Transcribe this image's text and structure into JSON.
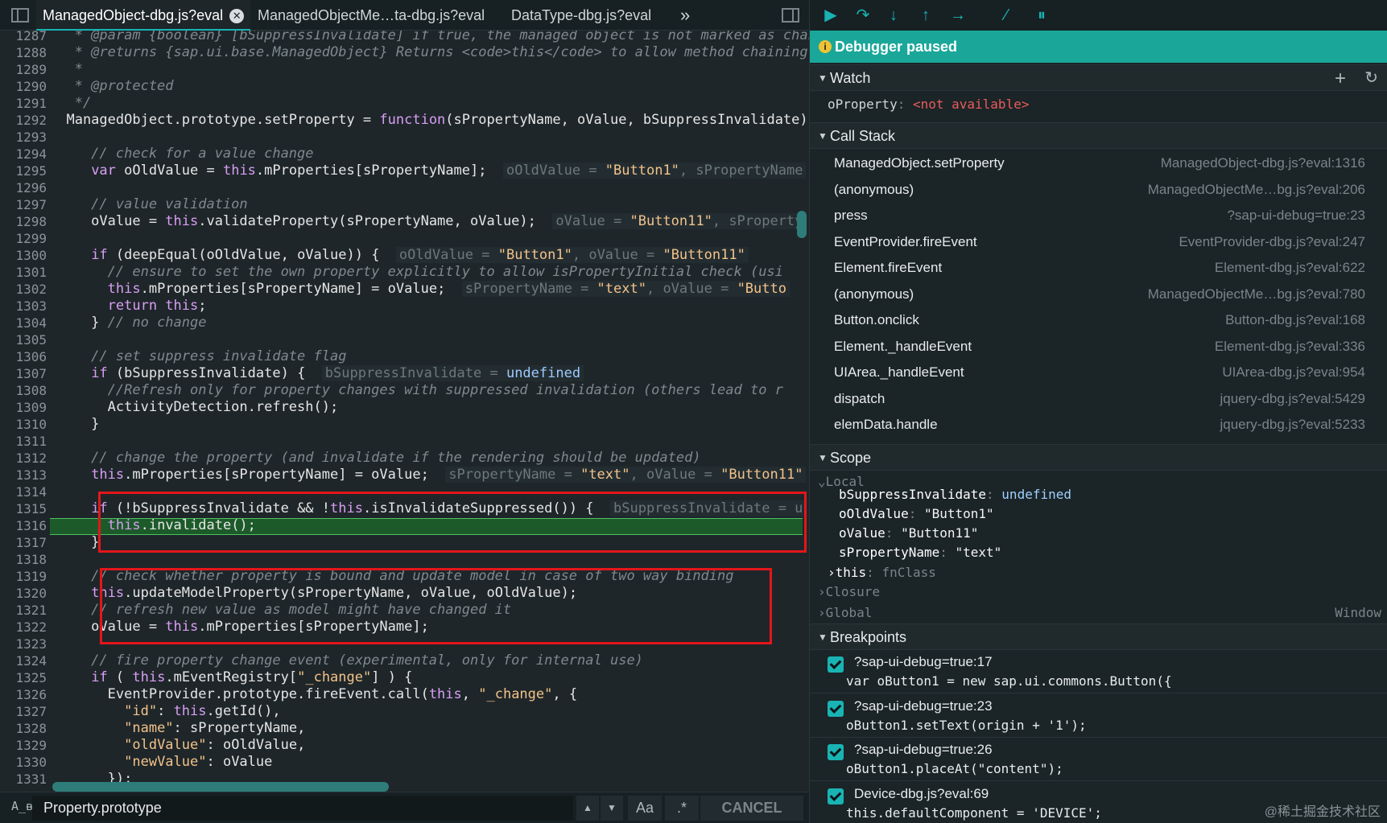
{
  "tabs": [
    {
      "label": "ManagedObject-dbg.js?eval",
      "active": true
    },
    {
      "label": "ManagedObjectMe…ta-dbg.js?eval",
      "active": false
    },
    {
      "label": "DataType-dbg.js?eval",
      "active": false
    }
  ],
  "tabs_more": "»",
  "editor": {
    "first_line": 1287,
    "lines": [
      {
        "n": "1287",
        "html": "<span class='cm'>   * @param {boolean} [bSuppressInvalidate] if true, the managed object is not marked as changed</span>"
      },
      {
        "n": "1288",
        "html": "<span class='cm'>   * @returns {sap.ui.base.ManagedObject} Returns &lt;code&gt;this&lt;/code&gt; to allow method chaining</span>"
      },
      {
        "n": "1289",
        "html": "<span class='cm'>   *</span>"
      },
      {
        "n": "1290",
        "html": "<span class='cm'>   * @protected</span>"
      },
      {
        "n": "1291",
        "html": "<span class='cm'>   */</span>"
      },
      {
        "n": "1292",
        "html": "  ManagedObject.prototype.setProperty = <span class='kw'>function</span>(sPropertyName, oValue, bSuppressInvalidate) {"
      },
      {
        "n": "1293",
        "html": ""
      },
      {
        "n": "1294",
        "html": "<span class='cm'>     // check for a value change</span>"
      },
      {
        "n": "1295",
        "html": "     <span class='kw'>var</span> oOldValue = <span class='kw'>this</span>.mProperties[sPropertyName];  <span class='inl'>oOldValue = <span class='st'>\"Button1\"</span>, sPropertyName</span>"
      },
      {
        "n": "1296",
        "html": ""
      },
      {
        "n": "1297",
        "html": "<span class='cm'>     // value validation</span>"
      },
      {
        "n": "1298",
        "html": "     oValue = <span class='kw'>this</span>.validateProperty(sPropertyName, oValue);  <span class='inl'>oValue = <span class='st'>\"Button11\"</span>, sProperty</span>"
      },
      {
        "n": "1299",
        "html": ""
      },
      {
        "n": "1300",
        "html": "     <span class='kw'>if</span> (deepEqual(oOldValue, oValue)) {  <span class='inl'>oOldValue = <span class='st'>\"Button1\"</span>, oValue = <span class='st'>\"Button11\"</span></span>"
      },
      {
        "n": "1301",
        "html": "<span class='cm'>       // ensure to set the own property explicitly to allow isPropertyInitial check (usi</span>"
      },
      {
        "n": "1302",
        "html": "       <span class='kw'>this</span>.mProperties[sPropertyName] = oValue;  <span class='inl'>sPropertyName = <span class='st'>\"text\"</span>, oValue = <span class='st'>\"Butto</span></span>"
      },
      {
        "n": "1303",
        "html": "       <span class='kw'>return this</span>;"
      },
      {
        "n": "1304",
        "html": "     } <span class='cm'>// no change</span>"
      },
      {
        "n": "1305",
        "html": ""
      },
      {
        "n": "1306",
        "html": "<span class='cm'>     // set suppress invalidate flag</span>"
      },
      {
        "n": "1307",
        "html": "     <span class='kw'>if</span> (bSuppressInvalidate) {  <span class='inl'>bSuppressInvalidate = <span class='kw'>undefined</span></span>"
      },
      {
        "n": "1308",
        "html": "<span class='cm'>       //Refresh only for property changes with suppressed invalidation (others lead to r</span>"
      },
      {
        "n": "1309",
        "html": "       ActivityDetection.refresh();"
      },
      {
        "n": "1310",
        "html": "     }"
      },
      {
        "n": "1311",
        "html": ""
      },
      {
        "n": "1312",
        "html": "<span class='cm'>     // change the property (and invalidate if the rendering should be updated)</span>"
      },
      {
        "n": "1313",
        "html": "     <span class='kw'>this</span>.mProperties[sPropertyName] = oValue;  <span class='inl'>sPropertyName = <span class='st'>\"text\"</span>, oValue = <span class='st'>\"Button11\"</span></span>"
      },
      {
        "n": "1314",
        "html": ""
      },
      {
        "n": "1315",
        "html": "     <span class='kw'>if</span> (!bSuppressInvalidate &amp;&amp; !<span class='kw'>this</span>.isInvalidateSuppressed()) {  <span class='inl'>bSuppressInvalidate = u</span>"
      },
      {
        "n": "1316",
        "html": "       <span class='kw'>this</span>.invalidate();"
      },
      {
        "n": "1317",
        "html": "     }"
      },
      {
        "n": "1318",
        "html": ""
      },
      {
        "n": "1319",
        "html": "<span class='cm'>     // check whether property is bound and update model in case of two way binding</span>"
      },
      {
        "n": "1320",
        "html": "     <span class='kw'>this</span>.updateModelProperty(sPropertyName, oValue, oOldValue);"
      },
      {
        "n": "1321",
        "html": "<span class='cm'>     // refresh new value as model might have changed it</span>"
      },
      {
        "n": "1322",
        "html": "     oValue = <span class='kw'>this</span>.mProperties[sPropertyName];"
      },
      {
        "n": "1323",
        "html": ""
      },
      {
        "n": "1324",
        "html": "<span class='cm'>     // fire property change event (experimental, only for internal use)</span>"
      },
      {
        "n": "1325",
        "html": "     <span class='kw'>if</span> ( <span class='kw'>this</span>.mEventRegistry[<span class='st'>\"_change\"</span>] ) {"
      },
      {
        "n": "1326",
        "html": "       EventProvider.prototype.fireEvent.call(<span class='kw'>this</span>, <span class='st'>\"_change\"</span>, {"
      },
      {
        "n": "1327",
        "html": "         <span class='st'>\"id\"</span>: <span class='kw'>this</span>.getId(),"
      },
      {
        "n": "1328",
        "html": "         <span class='st'>\"name\"</span>: sPropertyName,"
      },
      {
        "n": "1329",
        "html": "         <span class='st'>\"oldValue\"</span>: oOldValue,"
      },
      {
        "n": "1330",
        "html": "         <span class='st'>\"newValue\"</span>: oValue"
      },
      {
        "n": "1331",
        "html": "       });"
      }
    ],
    "paused_line": "1316"
  },
  "search": {
    "value": "Property.prototype",
    "case_label": "Aa",
    "regex_label": ".*",
    "cancel_label": "CANCEL"
  },
  "debugger": {
    "paused_label": "Debugger paused",
    "watch": {
      "title": "Watch",
      "add_label": "+",
      "items": [
        {
          "name": "oProperty",
          "value": "<not available>"
        }
      ]
    },
    "call_stack": {
      "title": "Call Stack",
      "frames": [
        {
          "fn": "ManagedObject.setProperty",
          "loc": "ManagedObject-dbg.js?eval:1316"
        },
        {
          "fn": "(anonymous)",
          "loc": "ManagedObjectMe…bg.js?eval:206"
        },
        {
          "fn": "press",
          "loc": "?sap-ui-debug=true:23"
        },
        {
          "fn": "EventProvider.fireEvent",
          "loc": "EventProvider-dbg.js?eval:247"
        },
        {
          "fn": "Element.fireEvent",
          "loc": "Element-dbg.js?eval:622"
        },
        {
          "fn": "(anonymous)",
          "loc": "ManagedObjectMe…bg.js?eval:780"
        },
        {
          "fn": "Button.onclick",
          "loc": "Button-dbg.js?eval:168"
        },
        {
          "fn": "Element._handleEvent",
          "loc": "Element-dbg.js?eval:336"
        },
        {
          "fn": "UIArea._handleEvent",
          "loc": "UIArea-dbg.js?eval:954"
        },
        {
          "fn": "dispatch",
          "loc": "jquery-dbg.js?eval:5429"
        },
        {
          "fn": "elemData.handle",
          "loc": "jquery-dbg.js?eval:5233"
        }
      ]
    },
    "scope": {
      "title": "Scope",
      "local_label": "Local",
      "vars": [
        {
          "name": "bSuppressInvalidate",
          "value": "undefined",
          "kind": "undef"
        },
        {
          "name": "oOldValue",
          "value": "\"Button1\"",
          "kind": "str"
        },
        {
          "name": "oValue",
          "value": "\"Button11\"",
          "kind": "str"
        },
        {
          "name": "sPropertyName",
          "value": "\"text\"",
          "kind": "str"
        }
      ],
      "this_name": "this",
      "this_value": "fnClass",
      "closure_label": "Closure",
      "global_label": "Global",
      "global_value": "Window"
    },
    "breakpoints": {
      "title": "Breakpoints",
      "items": [
        {
          "loc": "?sap-ui-debug=true:17",
          "code": "var oButton1 = new sap.ui.commons.Button({"
        },
        {
          "loc": "?sap-ui-debug=true:23",
          "code": "oButton1.setText(origin + '1');"
        },
        {
          "loc": "?sap-ui-debug=true:26",
          "code": "oButton1.placeAt(\"content\");"
        },
        {
          "loc": "Device-dbg.js?eval:69",
          "code": "this.defaultComponent = 'DEVICE';"
        }
      ]
    }
  },
  "watermark": "@稀土掘金技术社区",
  "colors": {
    "accent": "#19b3b3",
    "paused_bg": "#1aa79a",
    "exec_line": "#1d5a2a",
    "highlight_box": "#e3161b"
  }
}
